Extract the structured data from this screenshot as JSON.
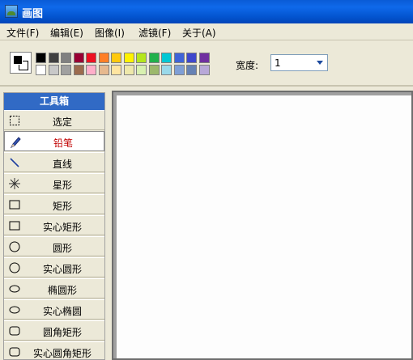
{
  "window": {
    "title": "画图"
  },
  "menu": [
    {
      "label": "文件(F)"
    },
    {
      "label": "编辑(E)"
    },
    {
      "label": "图像(I)"
    },
    {
      "label": "滤镜(F)"
    },
    {
      "label": "关于(A)"
    }
  ],
  "toolbar": {
    "width_label": "宽度:",
    "width_value": "1"
  },
  "palette": {
    "foreground": "#000000",
    "background": "#ffffff",
    "row1": [
      "#000000",
      "#404040",
      "#808080",
      "#990033",
      "#ee1122",
      "#ff7f27",
      "#ffc90e",
      "#fff200",
      "#b5e61d",
      "#22b14c",
      "#00c8d4",
      "#3f64d8",
      "#3f48cc",
      "#7030a0"
    ],
    "row2": [
      "#ffffff",
      "#c8c8c8",
      "#a0a0a0",
      "#9c6b4e",
      "#ffaec9",
      "#e6b98f",
      "#ffe5a0",
      "#eee8aa",
      "#d8f0b0",
      "#9cb86c",
      "#99d9ea",
      "#7f9fd6",
      "#6682b4",
      "#b8a8d8"
    ]
  },
  "toolbox": {
    "title": "工具箱",
    "tools": [
      {
        "label": "选定",
        "icon": "select-icon"
      },
      {
        "label": "铅笔",
        "icon": "pencil-icon",
        "active": true
      },
      {
        "label": "直线",
        "icon": "line-icon"
      },
      {
        "label": "星形",
        "icon": "star-icon"
      },
      {
        "label": "矩形",
        "icon": "rectangle-icon"
      },
      {
        "label": "实心矩形",
        "icon": "filled-rectangle-icon"
      },
      {
        "label": "圆形",
        "icon": "circle-icon"
      },
      {
        "label": "实心圆形",
        "icon": "filled-circle-icon"
      },
      {
        "label": "椭圆形",
        "icon": "ellipse-icon"
      },
      {
        "label": "实心椭圆",
        "icon": "filled-ellipse-icon"
      },
      {
        "label": "圆角矩形",
        "icon": "rounded-rectangle-icon"
      },
      {
        "label": "实心圆角矩形",
        "icon": "filled-rounded-rectangle-icon"
      }
    ]
  }
}
